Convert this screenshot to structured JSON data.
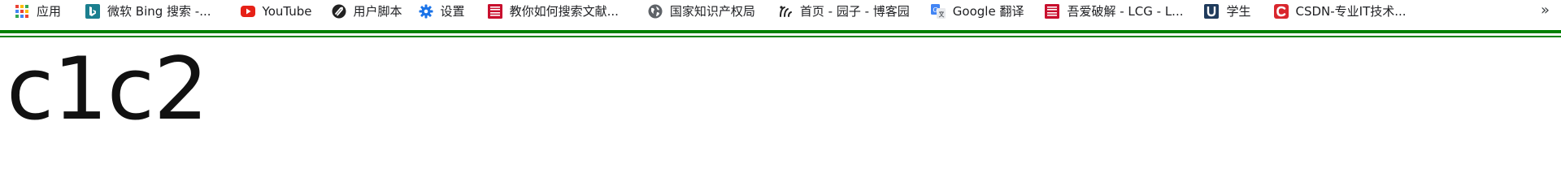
{
  "bookmarks_bar": {
    "items": [
      {
        "label": "应用",
        "icon": "apps-grid-icon"
      },
      {
        "label": "微软 Bing 搜索 -...",
        "icon": "bing-logo-icon"
      },
      {
        "label": "YouTube",
        "icon": "youtube-icon"
      },
      {
        "label": "用户脚本",
        "icon": "userscript-icon"
      },
      {
        "label": "设置",
        "icon": "gear-icon"
      },
      {
        "label": "教你如何搜索文献...",
        "icon": "red-badge-icon"
      },
      {
        "label": "国家知识产权局",
        "icon": "globe-icon"
      },
      {
        "label": "首页 - 园子 - 博客园",
        "icon": "cnblogs-icon"
      },
      {
        "label": "Google 翻译",
        "icon": "google-translate-icon"
      },
      {
        "label": "吾爱破解 - LCG - L...",
        "icon": "red-badge-icon"
      },
      {
        "label": "学生",
        "icon": "u-logo-icon"
      },
      {
        "label": "CSDN-专业IT技术...",
        "icon": "csdn-logo-icon"
      }
    ],
    "overflow_label": "»"
  },
  "content": {
    "heading": "c1c2"
  },
  "colors": {
    "rule": "#008000",
    "bing": "#1b7f8f",
    "youtube": "#e62117",
    "badge_red": "#c8102e",
    "csdn": "#d9272e",
    "u_logo": "#1f3b5c"
  },
  "badge_text": {
    "line1": "吾爱",
    "line2": "破解"
  }
}
